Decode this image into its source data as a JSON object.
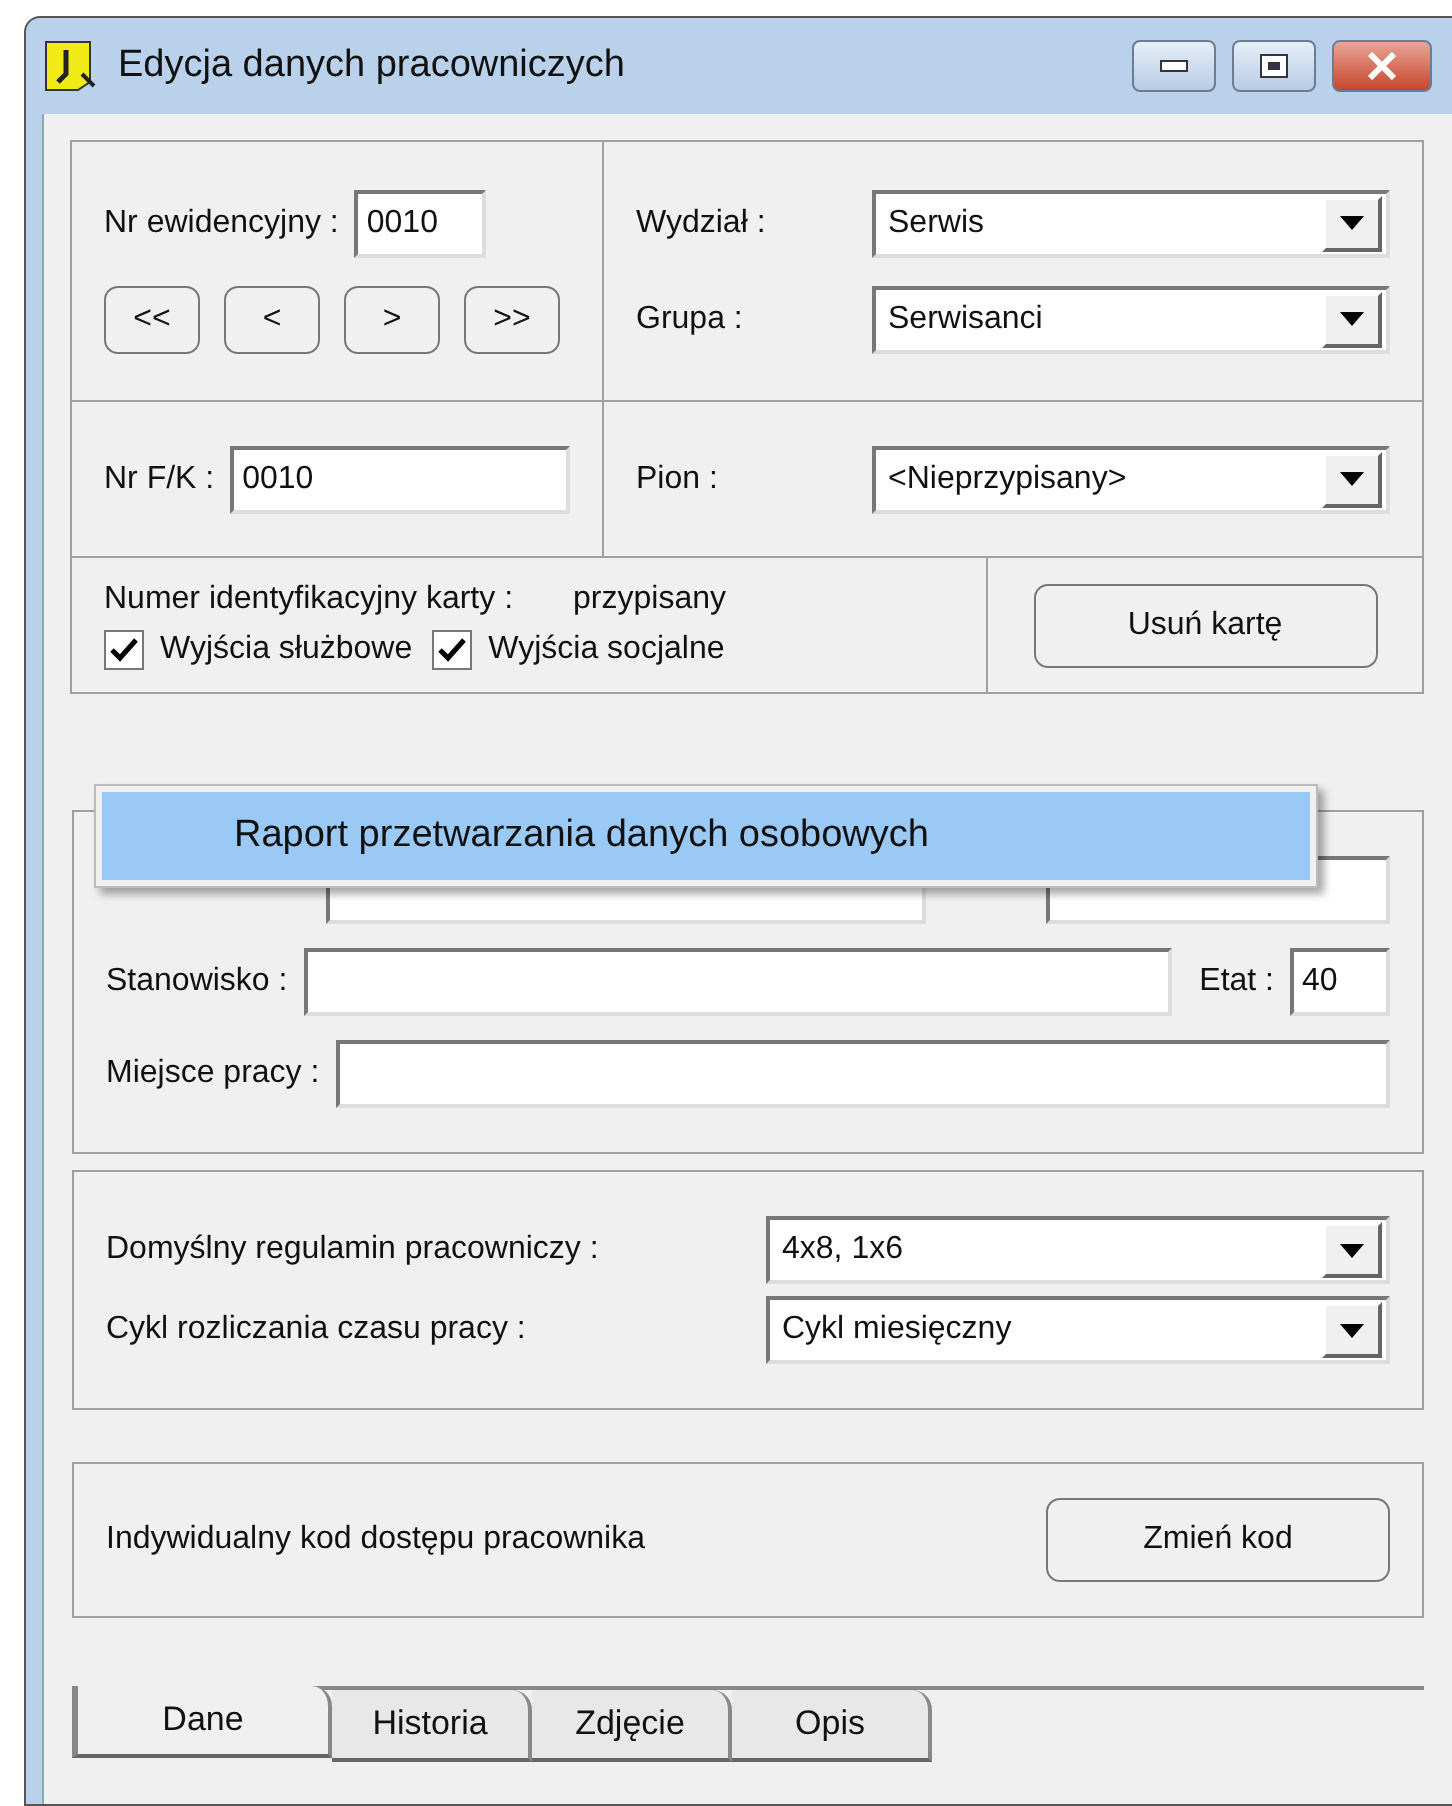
{
  "window": {
    "title": "Edycja danych pracowniczych"
  },
  "record": {
    "label": "Nr ewidencyjny :",
    "value": "0010",
    "nav_buttons": [
      "<<",
      "<",
      ">",
      ">>"
    ]
  },
  "department": {
    "label": "Wydział :",
    "value": "Serwis"
  },
  "group": {
    "label": "Grupa :",
    "value": "Serwisanci"
  },
  "fk": {
    "label": "Nr F/K :",
    "value": "0010"
  },
  "pion": {
    "label": "Pion :",
    "value": "<Nieprzypisany>"
  },
  "card": {
    "label": "Numer identyfikacyjny karty :",
    "status": "przypisany",
    "button": "Usuń kartę",
    "checkboxes": [
      {
        "label": "Wyjścia służbowe",
        "checked": true
      },
      {
        "label": "Wyjścia socjalne",
        "checked": true
      }
    ]
  },
  "popup_menu": {
    "items": [
      {
        "label": "Raport przetwarzania danych osobowych",
        "selected": true
      }
    ]
  },
  "position": {
    "label": "Stanowisko :",
    "etat_label": "Etat :",
    "etat_value": "40"
  },
  "workplace": {
    "label": "Miejsce pracy :"
  },
  "schedule": [
    {
      "label": "Domyślny regulamin pracowniczy :",
      "value": "4x8, 1x6"
    },
    {
      "label": "Cykl rozliczania czasu pracy :",
      "value": "Cykl miesięczny"
    }
  ],
  "access_code": {
    "label": "Indywidualny kod dostępu pracownika",
    "button": "Zmień kod"
  },
  "tabs": [
    {
      "label": "Dane",
      "selected": true
    },
    {
      "label": "Historia",
      "selected": false
    },
    {
      "label": "Zdjęcie",
      "selected": false
    },
    {
      "label": "Opis",
      "selected": false
    }
  ]
}
